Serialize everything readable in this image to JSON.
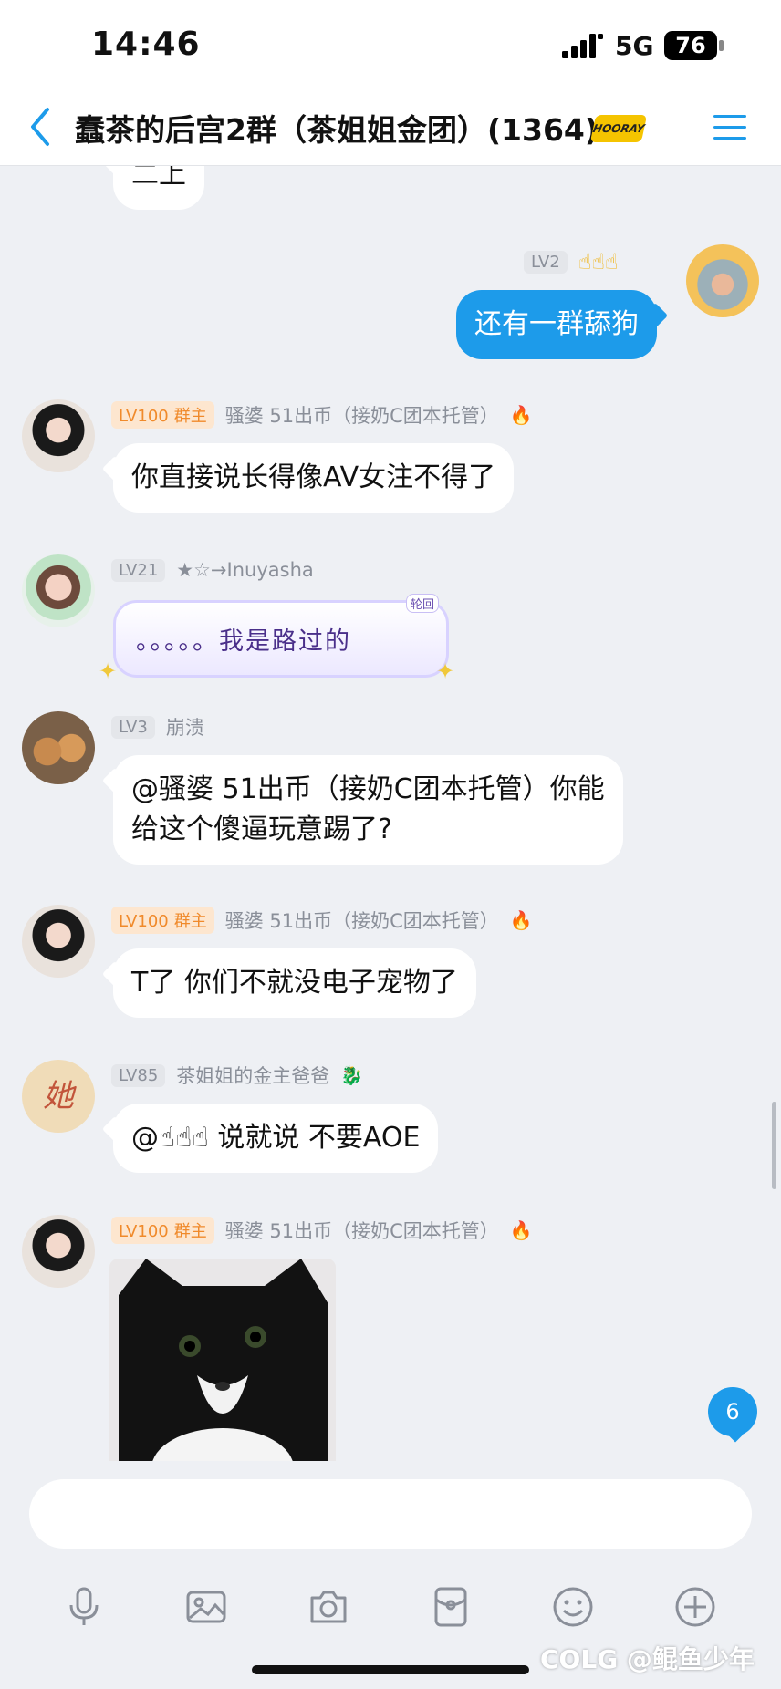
{
  "status_bar": {
    "time": "14:46",
    "network": "5G",
    "battery": "76"
  },
  "header": {
    "title": "蠢茶的后宫2群（茶姐姐金团）(1364)",
    "badge_text": "HOORAY"
  },
  "messages": [
    {
      "partial_text": "二上"
    },
    {
      "level": "LV2",
      "sender": "☝☝☝",
      "text": "还有一群舔狗",
      "self": true
    },
    {
      "level": "LV100",
      "role": "群主",
      "sender": "骚婆 51出币（接奶C团本托管）",
      "text": "你直接说长得像AV女注不得了"
    },
    {
      "level": "LV21",
      "sender": "★☆→Inuyasha",
      "text": "。。。。。我是路过的",
      "tag": "轮回"
    },
    {
      "level": "LV3",
      "sender": "崩溃",
      "text_lines": [
        "@骚婆 51出币（接奶C团本托管）你能",
        "给这个傻逼玩意踢了?"
      ]
    },
    {
      "level": "LV100",
      "role": "群主",
      "sender": "骚婆 51出币（接奶C团本托管）",
      "text": "T了  你们不就没电子宠物了"
    },
    {
      "level": "LV85",
      "sender": "茶姐姐的金主爸爸",
      "text": "@☝☝☝ 说就说  不要AOE"
    },
    {
      "level": "LV100",
      "role": "群主",
      "sender": "骚婆 51出币（接奶C团本托管）",
      "image": "cat-photo"
    }
  ],
  "unread_count": "6",
  "input": {
    "placeholder": ""
  },
  "toolbar_icons": [
    "microphone-icon",
    "image-icon",
    "camera-icon",
    "red-packet-icon",
    "emoji-icon",
    "plus-icon"
  ],
  "watermark": "COLG @鲲鱼少年",
  "colors": {
    "accent": "#1d9bea",
    "owner_level": "#f08a2b",
    "background": "#eef0f4"
  }
}
